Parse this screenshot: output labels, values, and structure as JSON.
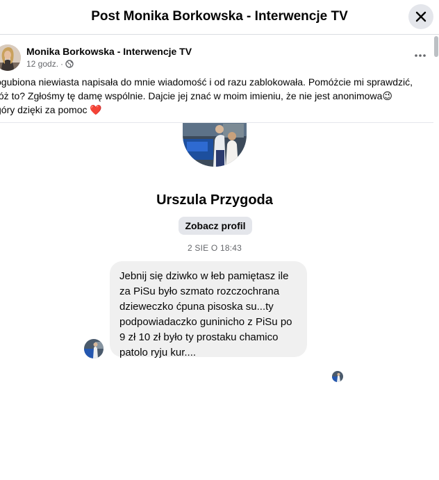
{
  "dialog": {
    "title": "Post Monika Borkowska - Interwencje TV",
    "close_icon": "close-icon"
  },
  "post": {
    "author": "Monika Borkowska - Interwencje TV",
    "time": "12 godz.",
    "separator": "·",
    "audience_icon": "globe-icon",
    "more_icon": "more-horizontal-icon",
    "text_lines": [
      "ogubiona niewiasta napisała do mnie wiadomość i od razu zablokowała. Pomóżcie mi sprawdzić,",
      "tóż to? Zgłośmy tę damę wspólnie. Dajcie jej znać w moim imieniu, że nie jest anonimowa😉",
      " góry dzięki za pomoc ❤️"
    ]
  },
  "screenshot": {
    "contact_name": "Urszula Przygoda",
    "view_profile_label": "Zobacz profil",
    "date": "2 SIE O 18:43",
    "message_lines": [
      "Jebnij się dziwko w łeb pamiętasz ile",
      "za PiSu było szmato rozczochrana",
      "dzieweczko ćpuna pisoska su...ty",
      "podpowiadaczko guninicho z PiSu po",
      "9 zł 10 zł było ty prostaku chamico",
      "patolo ryju kur...."
    ]
  },
  "colors": {
    "bubble": "#f0f0f0",
    "secondary_text": "#65676b",
    "button_bg": "#e4e6eb"
  }
}
